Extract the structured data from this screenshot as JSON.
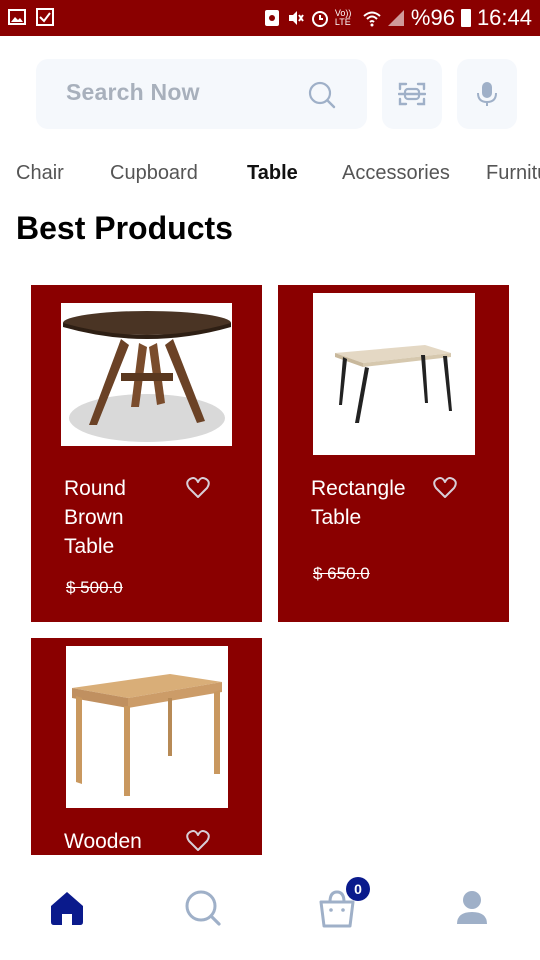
{
  "status_bar": {
    "battery_text": "%96",
    "time": "16:44",
    "volte": "Vo)) LTE"
  },
  "search": {
    "placeholder": "Search Now"
  },
  "categories": [
    "Chair",
    "Cupboard",
    "Table",
    "Accessories",
    "Furniture"
  ],
  "active_category": "Table",
  "section_title": "Best Products",
  "products": [
    {
      "name": "Round Brown Table",
      "price": "$ 500.0"
    },
    {
      "name": "Rectangle Table",
      "price": "$ 650.0"
    },
    {
      "name": "Wooden",
      "price": ""
    }
  ],
  "cart": {
    "count": "0"
  },
  "colors": {
    "primary": "#8a0000",
    "badge": "#0a1a8c",
    "nav_active": "#0a1a8c",
    "nav_inactive": "#9fb0c8"
  }
}
